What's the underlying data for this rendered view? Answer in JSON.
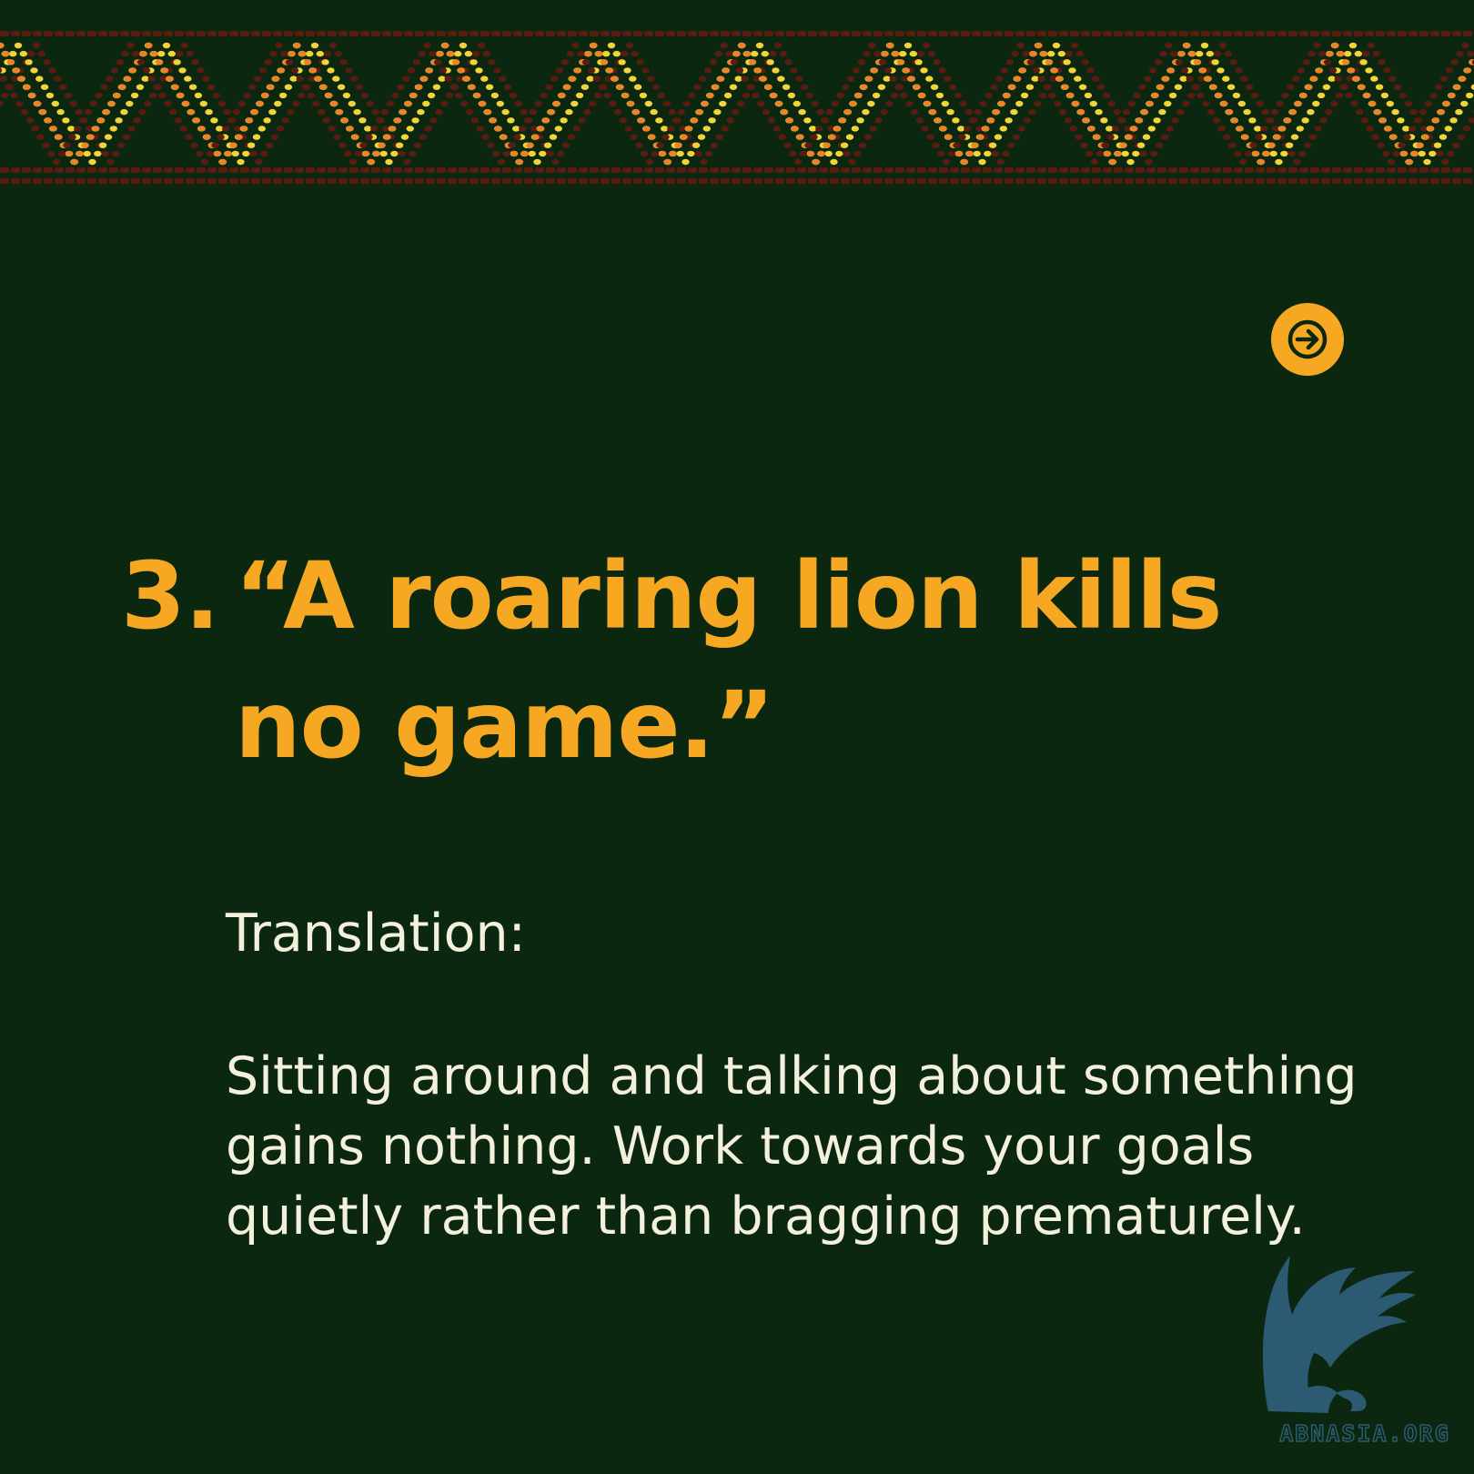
{
  "proverb": {
    "number": "3.",
    "text": "“A roaring lion kills no game.”"
  },
  "translation": {
    "label": "Translation:",
    "body": "Sitting around and talking about something gains nothing. Work towards your goals quietly rather than bragging prematurely."
  },
  "navigation": {
    "next_icon": "arrow-right-icon"
  },
  "logo": {
    "wordmark": "ABNASIA.ORG",
    "icon": "griffin-icon"
  },
  "colors": {
    "background": "#0b2710",
    "accent": "#f6a823",
    "body_text": "#f3f1dc",
    "border_yellow": "#f2d43a",
    "border_orange": "#e9842a",
    "border_brown": "#5a1c10",
    "logo_blue": "#2c5a72"
  }
}
